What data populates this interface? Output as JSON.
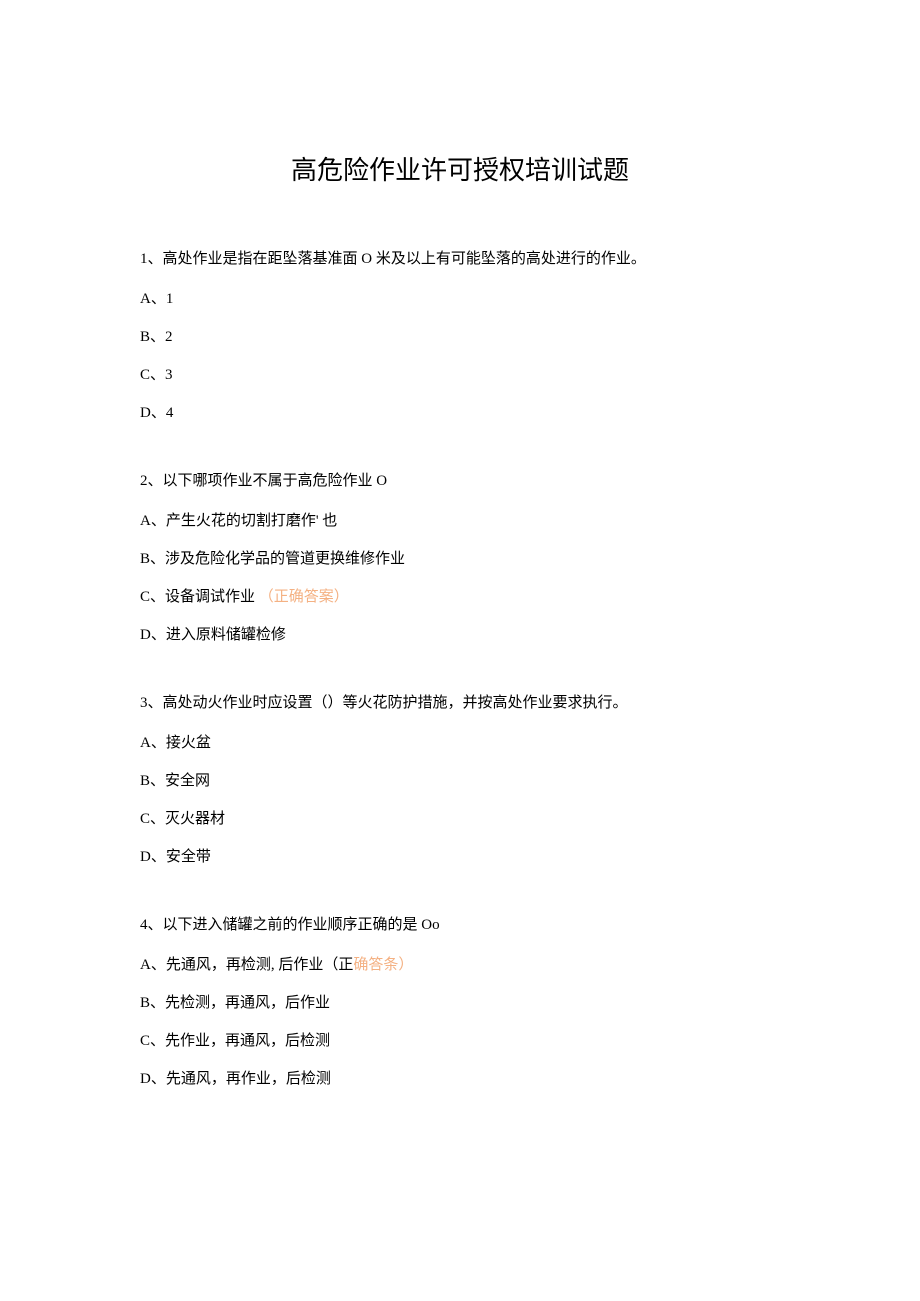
{
  "title": "高危险作业许可授权培训试题",
  "q1": {
    "stem": "1、高处作业是指在距坠落基准面 O 米及以上有可能坠落的高处进行的作业。",
    "a": "A、1",
    "b": "B、2",
    "c": "C、3",
    "d": "D、4"
  },
  "q2": {
    "stem": "2、以下哪项作业不属于高危险作业 O",
    "a": "A、产生火花的切割打磨作' 也",
    "b": "B、涉及危险化学品的管道更换维修作业",
    "c_pre": "C、设备调试作业",
    "c_ans": "（正确答案）",
    "d": "D、进入原料储罐检修"
  },
  "q3": {
    "stem": "3、高处动火作业时应设置（）等火花防护措施，并按高处作业要求执行。",
    "a": "A、接火盆",
    "b": "B、安全网",
    "c": "C、灭火器材",
    "d": "D、安全带"
  },
  "q4": {
    "stem": "4、以下进入储罐之前的作业顺序正确的是 Oo",
    "a_pre": "A、先通风，再检测, 后作业（正",
    "a_ans": "确答条）",
    "b": "B、先检测，再通风，后作业",
    "c": "C、先作业，再通风，后检测",
    "d": "D、先通风，再作业，后检测"
  }
}
